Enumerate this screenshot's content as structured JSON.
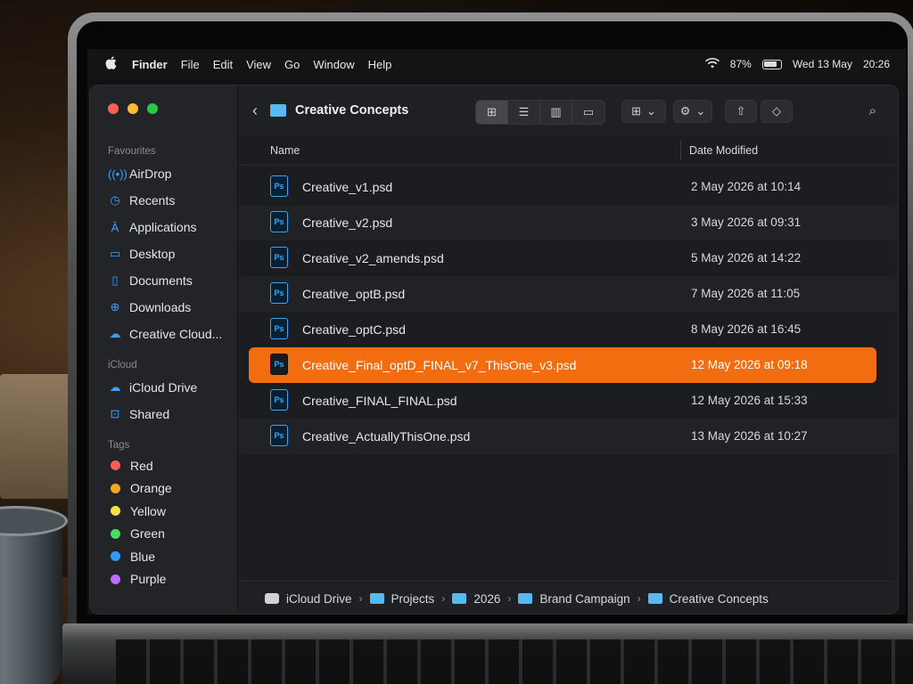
{
  "menubar": {
    "app_name": "Finder",
    "menus": [
      "File",
      "Edit",
      "View",
      "Go",
      "Window",
      "Help"
    ],
    "battery_percent": "87%",
    "battery_level": 0.87,
    "date": "Wed 13 May",
    "time": "20:26"
  },
  "sidebar": {
    "favourites_heading": "Favourites",
    "favourites": [
      {
        "label": "AirDrop",
        "icon": "airdrop-icon"
      },
      {
        "label": "Recents",
        "icon": "clock-icon"
      },
      {
        "label": "Applications",
        "icon": "applications-icon"
      },
      {
        "label": "Desktop",
        "icon": "desktop-icon"
      },
      {
        "label": "Documents",
        "icon": "document-icon"
      },
      {
        "label": "Downloads",
        "icon": "download-icon"
      },
      {
        "label": "Creative Cloud...",
        "icon": "creative-cloud-icon"
      }
    ],
    "icloud_heading": "iCloud",
    "icloud": [
      {
        "label": "iCloud Drive",
        "icon": "cloud-icon"
      },
      {
        "label": "Shared",
        "icon": "shared-folder-icon"
      }
    ],
    "tags_heading": "Tags",
    "tags": [
      {
        "label": "Red",
        "color": "#ff5b5b"
      },
      {
        "label": "Orange",
        "color": "#f5a623"
      },
      {
        "label": "Yellow",
        "color": "#f4e04d"
      },
      {
        "label": "Green",
        "color": "#4cd964"
      },
      {
        "label": "Blue",
        "color": "#2d9cff"
      },
      {
        "label": "Purple",
        "color": "#c06bff"
      }
    ]
  },
  "toolbar": {
    "title": "Creative Concepts"
  },
  "columns": {
    "name": "Name",
    "date_modified": "Date Modified"
  },
  "files": [
    {
      "name": "Creative_v1.psd",
      "date": "2 May 2026 at 10:14",
      "selected": false
    },
    {
      "name": "Creative_v2.psd",
      "date": "3 May 2026 at 09:31",
      "selected": false
    },
    {
      "name": "Creative_v2_amends.psd",
      "date": "5 May 2026 at 14:22",
      "selected": false
    },
    {
      "name": "Creative_optB.psd",
      "date": "7 May 2026 at 11:05",
      "selected": false
    },
    {
      "name": "Creative_optC.psd",
      "date": "8 May 2026 at 16:45",
      "selected": false
    },
    {
      "name": "Creative_Final_optD_FINAL_v7_ThisOne_v3.psd",
      "date": "12 May 2026 at 09:18",
      "selected": true
    },
    {
      "name": "Creative_FINAL_FINAL.psd",
      "date": "12 May 2026 at 15:33",
      "selected": false
    },
    {
      "name": "Creative_ActuallyThisOne.psd",
      "date": "13 May 2026 at 10:27",
      "selected": false
    }
  ],
  "file_badge": "Ps",
  "path": [
    "iCloud Drive",
    "Projects",
    "2026",
    "Brand Campaign",
    "Creative Concepts"
  ],
  "colors": {
    "selection": "#f26d0f",
    "accent": "#3aa0ff",
    "photoshop": "#31a8ff"
  }
}
